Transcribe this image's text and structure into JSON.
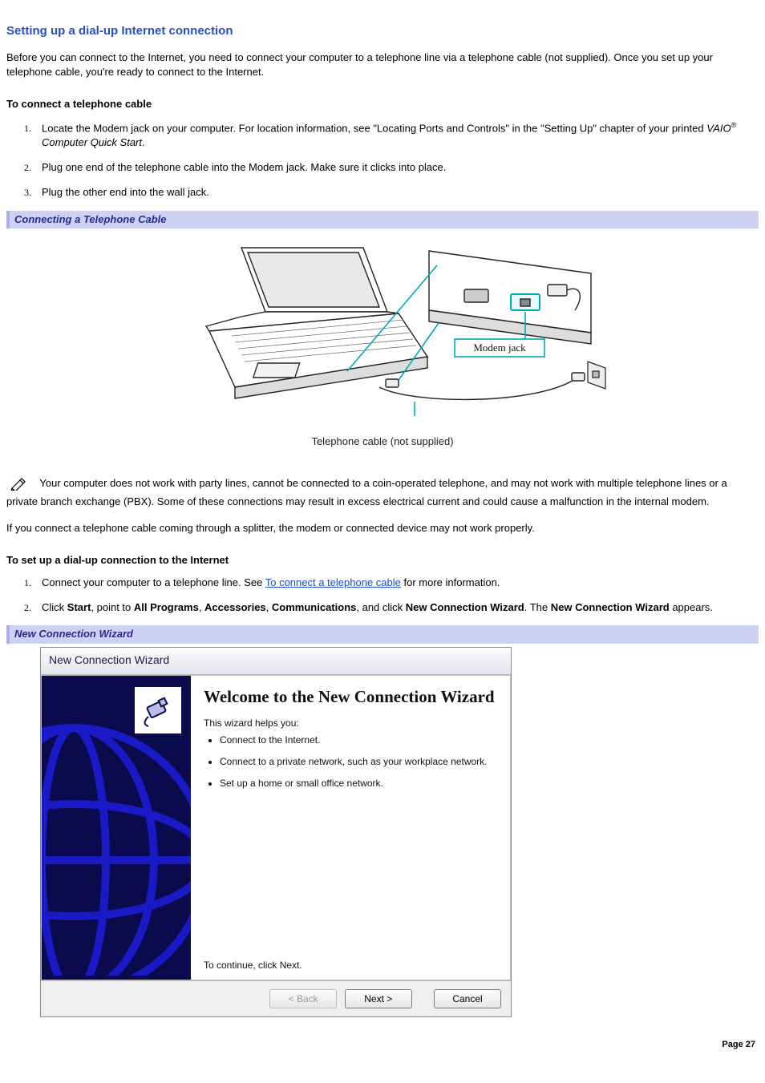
{
  "title": "Setting up a dial-up Internet connection",
  "intro": "Before you can connect to the Internet, you need to connect your computer to a telephone line via a telephone cable (not supplied). Once you set up your telephone cable, you're ready to connect to the Internet.",
  "section1": {
    "heading": "To connect a telephone cable",
    "steps": {
      "s1a": "Locate the Modem jack on your computer. For location information, see \"Locating Ports and Controls\" in the \"Setting Up\" chapter of your printed ",
      "s1b_italic": "VAIO",
      "s1c_reg": "®",
      "s1d_italic": " Computer Quick Start",
      "s1e": ".",
      "s2": "Plug one end of the telephone cable into the Modem jack. Make sure it clicks into place.",
      "s3": "Plug the other end into the wall jack."
    }
  },
  "figure1": {
    "bar": "Connecting a Telephone Cable",
    "label_modem": "Modem jack",
    "caption": "Telephone cable (not supplied)"
  },
  "note1_lead": "Your computer does not work with party lines, cannot be connected to a coin-operated telephone, and may not work with multiple telephone lines or a private branch exchange (PBX). Some of these connections may result in excess electrical current and could cause a malfunction in the internal modem.",
  "note2": "If you connect a telephone cable coming through a splitter, the modem or connected device may not work properly.",
  "section2": {
    "heading": "To set up a dial-up connection to the Internet",
    "steps": {
      "s1a": "Connect your computer to a telephone line. See ",
      "s1link": "To connect a telephone cable",
      "s1b": " for more information.",
      "s2a": "Click ",
      "s2b": "Start",
      "s2c": ", point to ",
      "s2d": "All Programs",
      "s2e": ", ",
      "s2f": "Accessories",
      "s2g": ", ",
      "s2h": "Communications",
      "s2i": ", and click ",
      "s2j": "New Connection Wizard",
      "s2k": ". The ",
      "s2l": "New Connection Wizard",
      "s2m": " appears."
    }
  },
  "figure2": {
    "bar": "New Connection Wizard"
  },
  "wizard": {
    "titlebar": "New Connection Wizard",
    "heading": "Welcome to the New Connection Wizard",
    "helps": "This wizard helps you:",
    "bullets": {
      "b1": "Connect to the Internet.",
      "b2": "Connect to a private network, such as your workplace network.",
      "b3": "Set up a home or small office network."
    },
    "continue": "To continue, click Next.",
    "buttons": {
      "back": "< Back",
      "next": "Next >",
      "cancel": "Cancel"
    }
  },
  "page_label": "Page 27"
}
